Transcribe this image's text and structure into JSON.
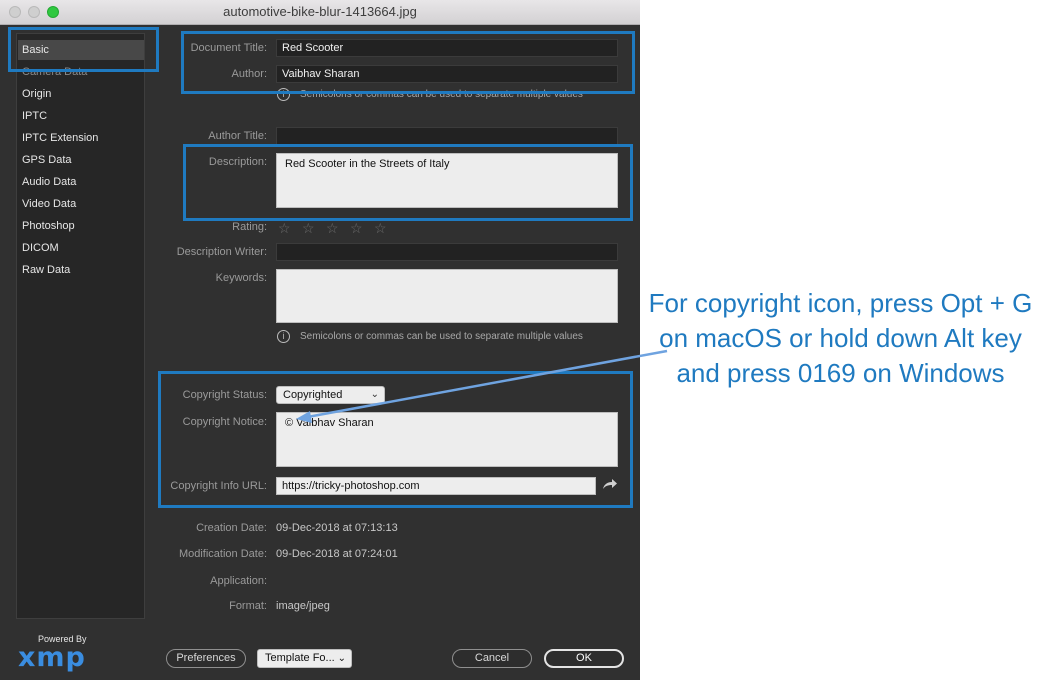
{
  "window": {
    "title": "automotive-bike-blur-1413664.jpg"
  },
  "sidebar": {
    "items": [
      "Basic",
      "Camera Data",
      "Origin",
      "IPTC",
      "IPTC Extension",
      "GPS Data",
      "Audio Data",
      "Video Data",
      "Photoshop",
      "DICOM",
      "Raw Data"
    ],
    "selected": "Basic"
  },
  "form": {
    "document_title_label": "Document Title:",
    "document_title_value": "Red Scooter",
    "author_label": "Author:",
    "author_value": "Vaibhav Sharan",
    "author_hint": "Semicolons or commas can be used to separate multiple values",
    "author_title_label": "Author Title:",
    "author_title_value": "",
    "description_label": "Description:",
    "description_value": "Red Scooter in the Streets of Italy",
    "rating_label": "Rating:",
    "rating_value": 0,
    "rating_max": 5,
    "description_writer_label": "Description Writer:",
    "description_writer_value": "",
    "keywords_label": "Keywords:",
    "keywords_value": "",
    "keywords_hint": "Semicolons or commas can be used to separate multiple values",
    "copyright_status_label": "Copyright Status:",
    "copyright_status_value": "Copyrighted",
    "copyright_notice_label": "Copyright Notice:",
    "copyright_notice_value": "© Vaibhav Sharan",
    "copyright_url_label": "Copyright Info URL:",
    "copyright_url_value": "https://tricky-photoshop.com",
    "creation_date_label": "Creation Date:",
    "creation_date_value": "09-Dec-2018 at 07:13:13",
    "modification_date_label": "Modification Date:",
    "modification_date_value": "09-Dec-2018 at 07:24:01",
    "application_label": "Application:",
    "application_value": "",
    "format_label": "Format:",
    "format_value": "image/jpeg"
  },
  "footer": {
    "powered_by": "Powered By",
    "logo_text": "xmp",
    "preferences_label": "Preferences",
    "template_label": "Template Fo...",
    "cancel_label": "Cancel",
    "ok_label": "OK"
  },
  "annotation": {
    "text": "For copyright icon, press Opt + G on macOS or hold down Alt key and press 0169 on Windows",
    "color": "#1f7ac0"
  },
  "icons": [
    "info-icon",
    "star-icon",
    "chevron-down-icon",
    "share-icon"
  ]
}
